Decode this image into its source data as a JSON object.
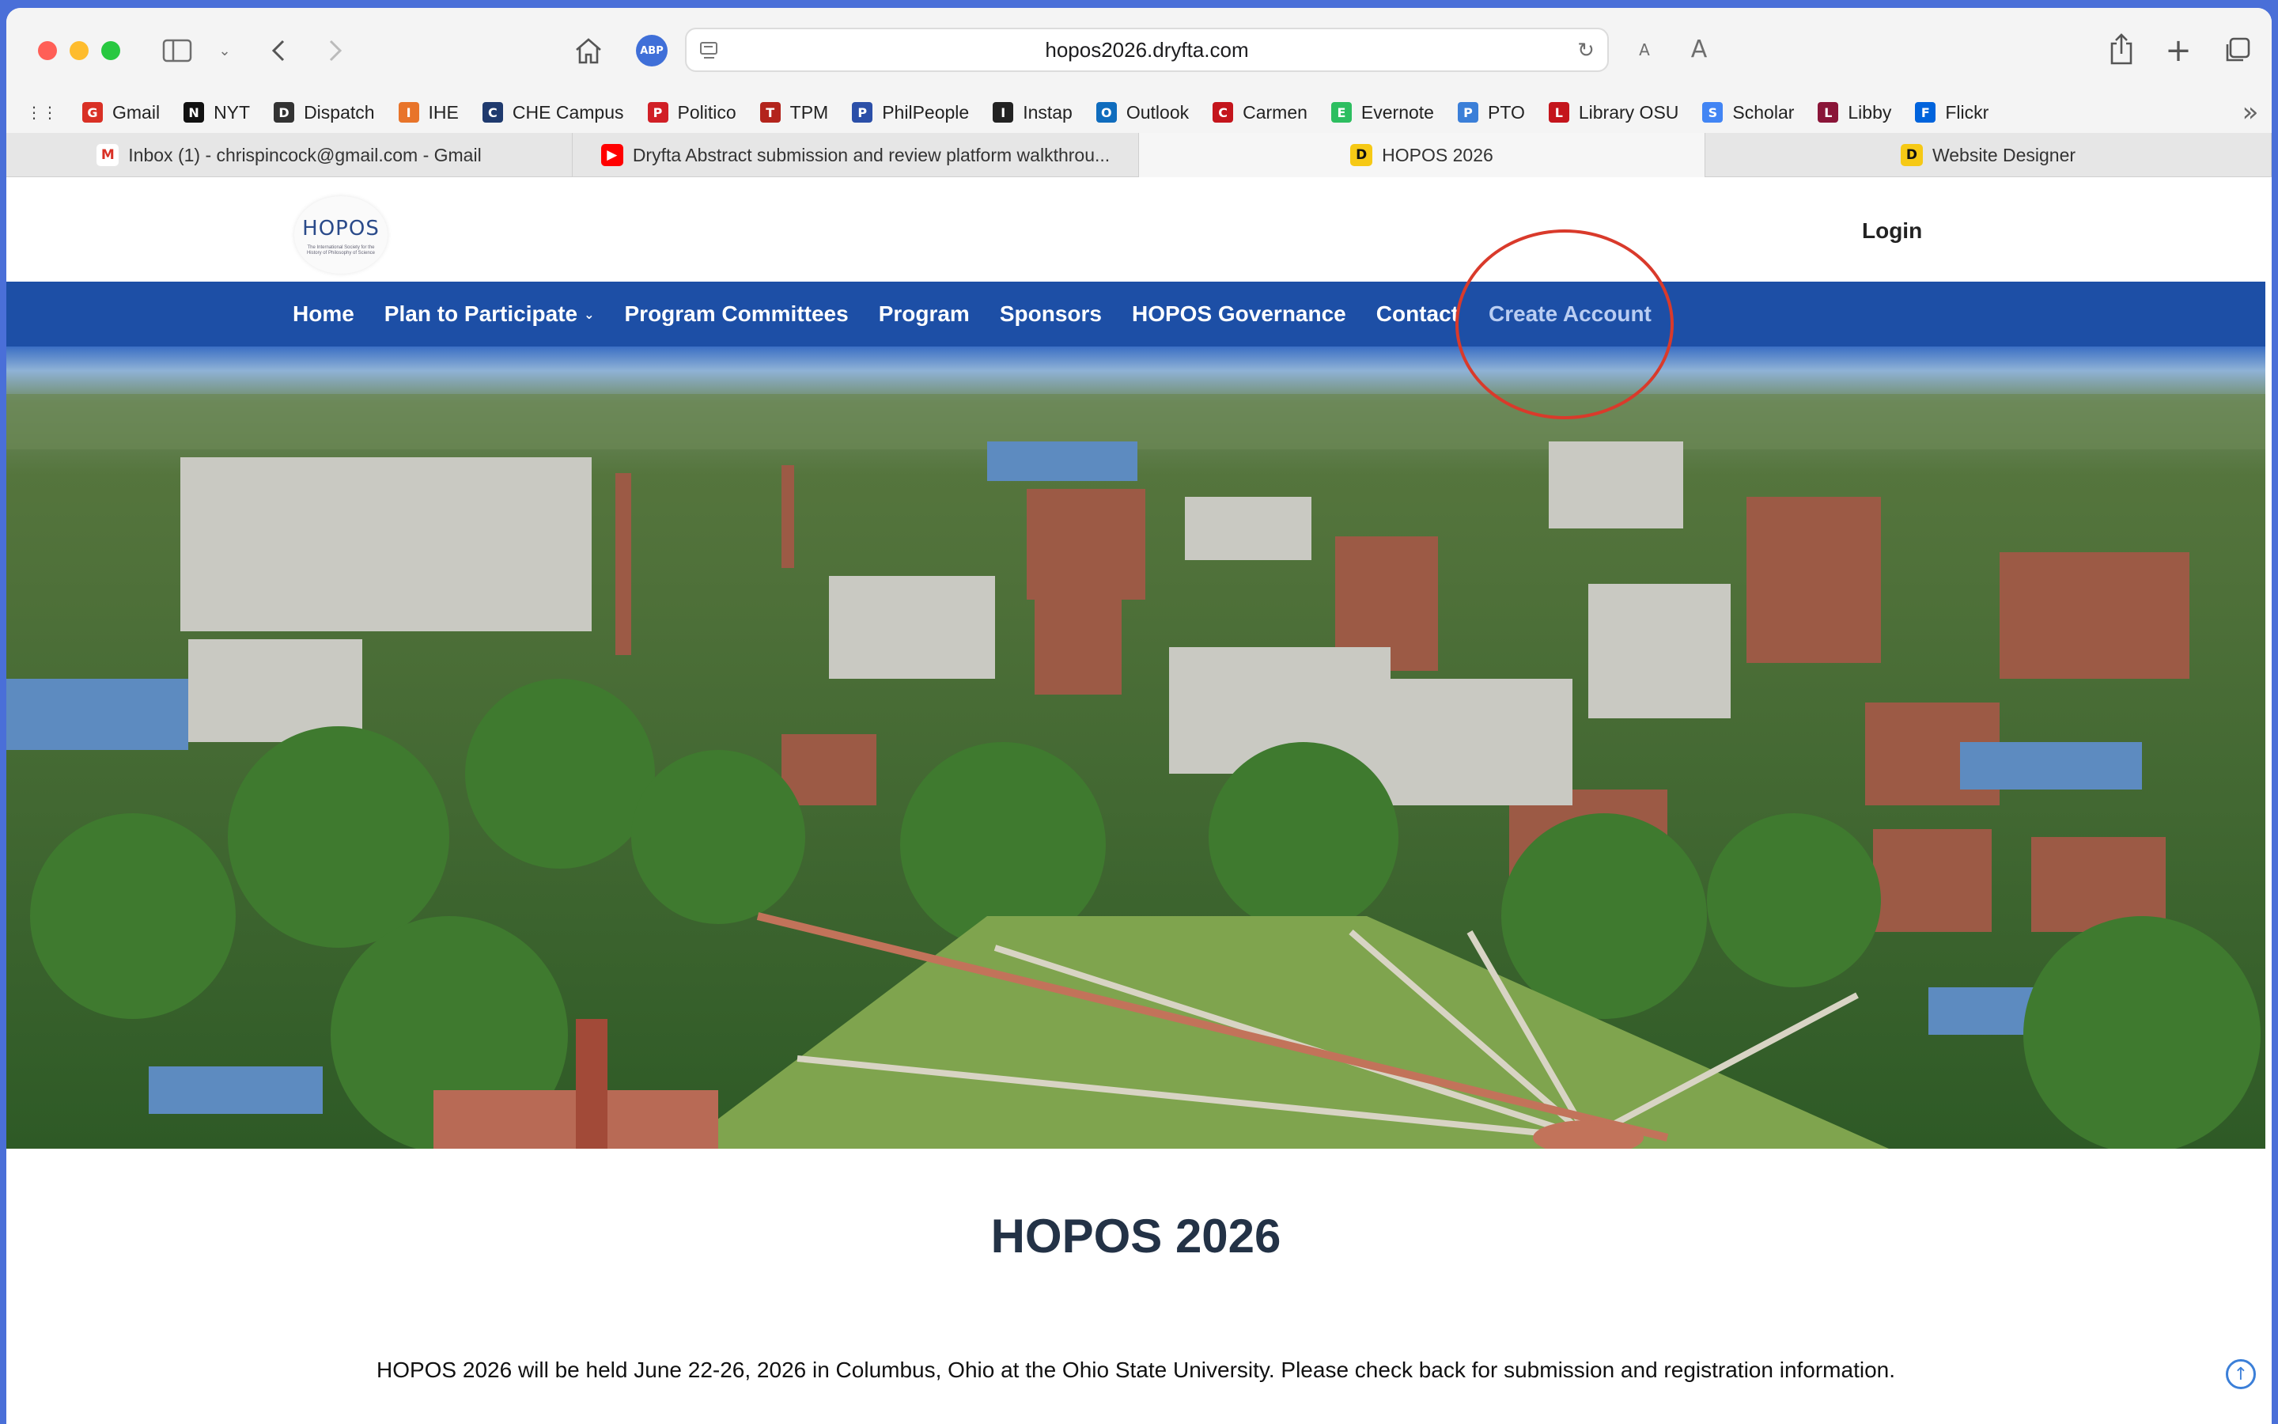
{
  "browser": {
    "url": "hopos2026.dryfta.com",
    "bookmarks": [
      {
        "label": "Gmail",
        "icon": "gmail-icon",
        "color": "#d93025"
      },
      {
        "label": "NYT",
        "icon": "nyt-icon",
        "color": "#111111"
      },
      {
        "label": "Dispatch",
        "icon": "dispatch-icon",
        "color": "#333333"
      },
      {
        "label": "IHE",
        "icon": "ihe-icon",
        "color": "#e8742a"
      },
      {
        "label": "CHE Campus",
        "icon": "che-icon",
        "color": "#1f3a6e"
      },
      {
        "label": "Politico",
        "icon": "politico-icon",
        "color": "#d11f26"
      },
      {
        "label": "TPM",
        "icon": "tpm-icon",
        "color": "#b3241c"
      },
      {
        "label": "PhilPeople",
        "icon": "philpeople-icon",
        "color": "#2b4fa8"
      },
      {
        "label": "Instap",
        "icon": "instapaper-icon",
        "color": "#222222"
      },
      {
        "label": "Outlook",
        "icon": "outlook-icon",
        "color": "#0f6cbd"
      },
      {
        "label": "Carmen",
        "icon": "carmen-icon",
        "color": "#c4151c"
      },
      {
        "label": "Evernote",
        "icon": "evernote-icon",
        "color": "#2dbe60"
      },
      {
        "label": "PTO",
        "icon": "pto-icon",
        "color": "#3b7fd8"
      },
      {
        "label": "Library OSU",
        "icon": "osu-library-icon",
        "color": "#c4151c"
      },
      {
        "label": "Scholar",
        "icon": "scholar-icon",
        "color": "#4285f4"
      },
      {
        "label": "Libby",
        "icon": "libby-icon",
        "color": "#8a1538"
      },
      {
        "label": "Flickr",
        "icon": "flickr-icon",
        "color": "#0063dc"
      }
    ],
    "tabs": [
      {
        "label": "Inbox (1) - chrispincock@gmail.com - Gmail",
        "icon": "gmail-icon"
      },
      {
        "label": "Dryfta Abstract submission and review platform walkthrou...",
        "icon": "youtube-icon"
      },
      {
        "label": "HOPOS 2026",
        "icon": "dryfta-icon",
        "active": true
      },
      {
        "label": "Website Designer",
        "icon": "dryfta-icon"
      }
    ]
  },
  "site": {
    "logo_text": "HOPOS",
    "logo_subtitle": "The International Society for the History of Philosophy of Science",
    "login": "Login",
    "nav": [
      {
        "label": "Home"
      },
      {
        "label": "Plan to Participate",
        "dropdown": true
      },
      {
        "label": "Program Committees"
      },
      {
        "label": "Program"
      },
      {
        "label": "Sponsors"
      },
      {
        "label": "HOPOS Governance"
      },
      {
        "label": "Contact"
      },
      {
        "label": "Create Account",
        "highlighted": true
      }
    ],
    "heading": "HOPOS 2026",
    "intro": "HOPOS 2026 will be held June 22-26, 2026 in Columbus, Ohio at the Ohio State University. Please check back for submission and registration information."
  },
  "colors": {
    "nav_bg": "#1d4fa6",
    "annotation_circle": "#d93a2b",
    "heading": "#233246"
  }
}
